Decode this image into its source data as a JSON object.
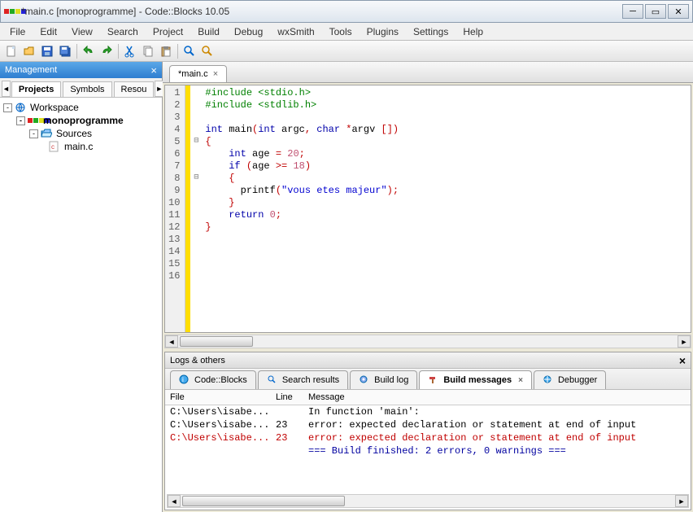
{
  "window": {
    "title": "*main.c [monoprogramme] - Code::Blocks 10.05"
  },
  "menu": {
    "items": [
      "File",
      "Edit",
      "View",
      "Search",
      "Project",
      "Build",
      "Debug",
      "wxSmith",
      "Tools",
      "Plugins",
      "Settings",
      "Help"
    ]
  },
  "management": {
    "header": "Management",
    "tabs": [
      "Projects",
      "Symbols",
      "Resou"
    ],
    "tree": {
      "workspace": "Workspace",
      "project": "monoprogramme",
      "sources": "Sources",
      "file": "main.c"
    }
  },
  "editor": {
    "tab": "*main.c",
    "lines": 16,
    "code": [
      {
        "n": 1,
        "tokens": [
          {
            "c": "tok-pp",
            "t": "#include <stdio.h>"
          }
        ]
      },
      {
        "n": 2,
        "tokens": [
          {
            "c": "tok-pp",
            "t": "#include <stdlib.h>"
          }
        ]
      },
      {
        "n": 3,
        "tokens": []
      },
      {
        "n": 4,
        "tokens": [
          {
            "c": "tok-kw",
            "t": "int "
          },
          {
            "c": "tok-fn",
            "t": "main"
          },
          {
            "c": "tok-op",
            "t": "("
          },
          {
            "c": "tok-kw",
            "t": "int "
          },
          {
            "c": "tok-pl",
            "t": "argc"
          },
          {
            "c": "tok-op",
            "t": ", "
          },
          {
            "c": "tok-kw",
            "t": "char "
          },
          {
            "c": "tok-op",
            "t": "*"
          },
          {
            "c": "tok-pl",
            "t": "argv "
          },
          {
            "c": "tok-op",
            "t": "[])"
          }
        ]
      },
      {
        "n": 5,
        "fold": "⊟",
        "tokens": [
          {
            "c": "tok-br",
            "t": "{"
          }
        ]
      },
      {
        "n": 6,
        "tokens": [
          {
            "c": "tok-pl",
            "t": "    "
          },
          {
            "c": "tok-kw",
            "t": "int "
          },
          {
            "c": "tok-pl",
            "t": "age "
          },
          {
            "c": "tok-op",
            "t": "= "
          },
          {
            "c": "tok-num",
            "t": "20"
          },
          {
            "c": "tok-op",
            "t": ";"
          }
        ]
      },
      {
        "n": 7,
        "tokens": [
          {
            "c": "tok-pl",
            "t": "    "
          },
          {
            "c": "tok-kw",
            "t": "if "
          },
          {
            "c": "tok-op",
            "t": "("
          },
          {
            "c": "tok-pl",
            "t": "age "
          },
          {
            "c": "tok-op",
            "t": ">= "
          },
          {
            "c": "tok-num",
            "t": "18"
          },
          {
            "c": "tok-op",
            "t": ")"
          }
        ]
      },
      {
        "n": 8,
        "fold": "⊟",
        "tokens": [
          {
            "c": "tok-pl",
            "t": "    "
          },
          {
            "c": "tok-br",
            "t": "{"
          }
        ]
      },
      {
        "n": 9,
        "tokens": [
          {
            "c": "tok-pl",
            "t": "      printf"
          },
          {
            "c": "tok-op",
            "t": "("
          },
          {
            "c": "tok-str",
            "t": "\"vous etes majeur\""
          },
          {
            "c": "tok-op",
            "t": ");"
          }
        ]
      },
      {
        "n": 10,
        "tokens": [
          {
            "c": "tok-pl",
            "t": "    "
          },
          {
            "c": "tok-br",
            "t": "}"
          }
        ]
      },
      {
        "n": 11,
        "tokens": [
          {
            "c": "tok-pl",
            "t": "    "
          },
          {
            "c": "tok-kw",
            "t": "return "
          },
          {
            "c": "tok-num",
            "t": "0"
          },
          {
            "c": "tok-op",
            "t": ";"
          }
        ]
      },
      {
        "n": 12,
        "tokens": [
          {
            "c": "tok-br",
            "t": "}"
          }
        ]
      },
      {
        "n": 13,
        "tokens": []
      },
      {
        "n": 14,
        "tokens": []
      },
      {
        "n": 15,
        "tokens": []
      },
      {
        "n": 16,
        "tokens": []
      }
    ]
  },
  "logs": {
    "header": "Logs & others",
    "tabs": [
      "Code::Blocks",
      "Search results",
      "Build log",
      "Build messages",
      "Debugger"
    ],
    "activeTab": 3,
    "columns": [
      "File",
      "Line",
      "Message"
    ],
    "rows": [
      {
        "cls": "",
        "file": "C:\\Users\\isabe...",
        "line": "",
        "msg": "In function 'main':"
      },
      {
        "cls": "",
        "file": "C:\\Users\\isabe...",
        "line": "23",
        "msg": "error: expected declaration or statement at end of input"
      },
      {
        "cls": "err",
        "file": "C:\\Users\\isabe...",
        "line": "23",
        "msg": "error: expected declaration or statement at end of input"
      },
      {
        "cls": "info",
        "file": "",
        "line": "",
        "msg": "=== Build finished: 2 errors, 0 warnings ==="
      }
    ]
  }
}
